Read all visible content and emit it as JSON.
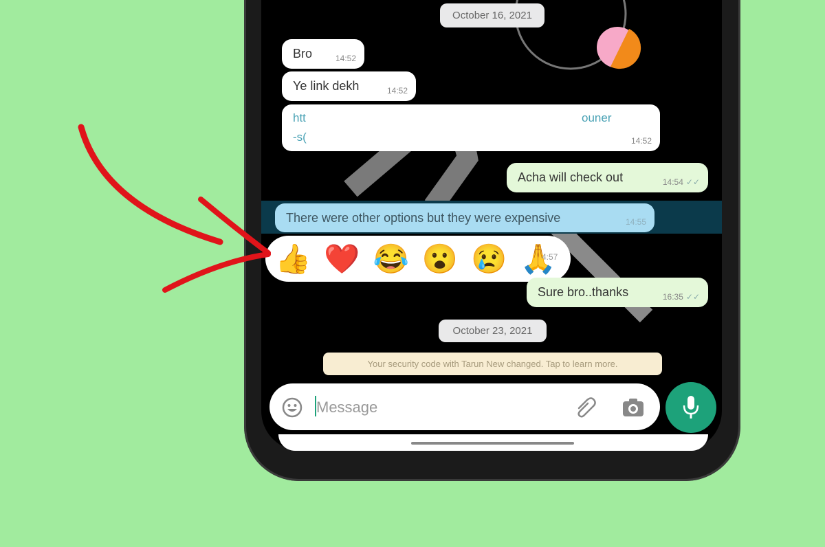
{
  "chat": {
    "dates": [
      "October 16, 2021",
      "October 23, 2021"
    ],
    "messages": [
      {
        "text": "Bro",
        "time": "14:52",
        "direction": "incoming"
      },
      {
        "text": "Ye link dekh",
        "time": "14:52",
        "direction": "incoming"
      },
      {
        "line1_start": "htt",
        "line1_end": "ouner",
        "line2_start": "-s(",
        "time": "14:52",
        "direction": "incoming"
      },
      {
        "text": "Acha will check out",
        "time": "14:54",
        "direction": "outgoing",
        "ticks": "✓✓"
      },
      {
        "text": "There were other options but they were expensive",
        "time": "14:55",
        "direction": "incoming",
        "selected": true
      },
      {
        "text": "Sure bro..thanks",
        "time": "16:35",
        "direction": "outgoing",
        "ticks": "✓✓"
      }
    ],
    "reactions": {
      "emojis": [
        "👍",
        "❤️",
        "😂",
        "😮",
        "😢",
        "🙏"
      ],
      "time": "4:57"
    },
    "security_notice": "Your security code with Tarun New changed. Tap to learn more."
  },
  "composer": {
    "placeholder": "Message",
    "icons": [
      "emoji-icon",
      "attach-icon",
      "camera-icon",
      "mic-icon"
    ]
  },
  "colors": {
    "background": "#a1eb9e",
    "selected_bubble": "#a9dcf2",
    "outgoing_bubble": "#e4f8d9",
    "mic_button": "#1da27a",
    "arrow": "#e0141a"
  }
}
